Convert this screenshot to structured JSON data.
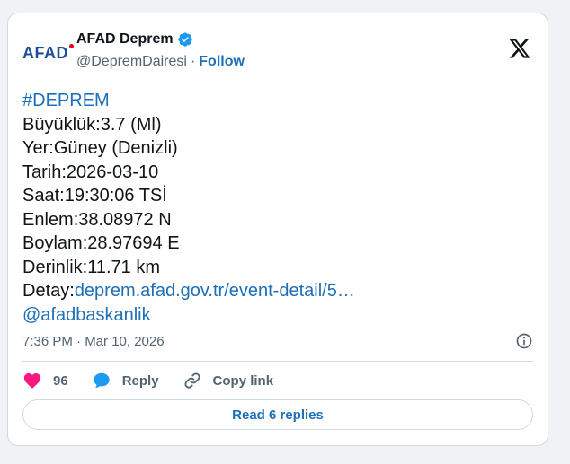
{
  "author": {
    "logo_text": "AFAD",
    "display_name": "AFAD Deprem",
    "handle": "@DepremDairesi",
    "separator": "·",
    "follow_label": "Follow"
  },
  "tweet": {
    "hashtag": "#DEPREM",
    "lines": [
      "Büyüklük:3.7 (Ml)",
      "Yer:Güney (Denizli)",
      "Tarih:2026-03-10",
      "Saat:19:30:06 TSİ",
      "Enlem:38.08972 N",
      "Boylam:28.97694 E",
      "Derinlik:11.71 km"
    ],
    "detail_prefix": "Detay:",
    "detail_link": "deprem.afad.gov.tr/event-detail/5…",
    "mention": "@afadbaskanlik",
    "timestamp": "7:36 PM · Mar 10, 2026"
  },
  "actions": {
    "like_count": "96",
    "reply_label": "Reply",
    "copy_link_label": "Copy link"
  },
  "replies_button": "Read 6 replies",
  "colors": {
    "accent": "#1d6fb8",
    "verified": "#1d9bf0",
    "heart": "#f91880",
    "muted": "#536471",
    "border": "#cfd9de"
  },
  "icons": [
    "verified-badge-icon",
    "x-logo-icon",
    "info-icon",
    "heart-icon",
    "reply-bubble-icon",
    "link-icon"
  ]
}
